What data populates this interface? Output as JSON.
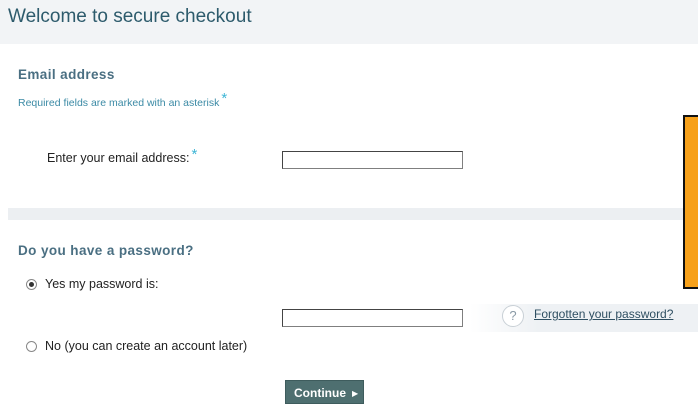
{
  "header": {
    "title": "Welcome to secure checkout"
  },
  "email_section": {
    "heading": "Email address",
    "required_note": "Required fields are marked with an asterisk",
    "asterisk": "*",
    "email_label": "Enter your email address:",
    "email_value": ""
  },
  "password_section": {
    "heading": "Do you have a password?",
    "option_yes": "Yes my password is:",
    "option_no": "No (you can create an account later)",
    "selected_option": "yes",
    "password_value": "",
    "help_icon": "?",
    "forgot_link": "Forgotten your password?"
  },
  "actions": {
    "continue_label": "Continue",
    "continue_arrow": "▶"
  },
  "colors": {
    "accent": "#2d5b6c",
    "asterisk": "#3fb6d6",
    "button": "#4e6f70",
    "promo": "#f7a11a"
  }
}
